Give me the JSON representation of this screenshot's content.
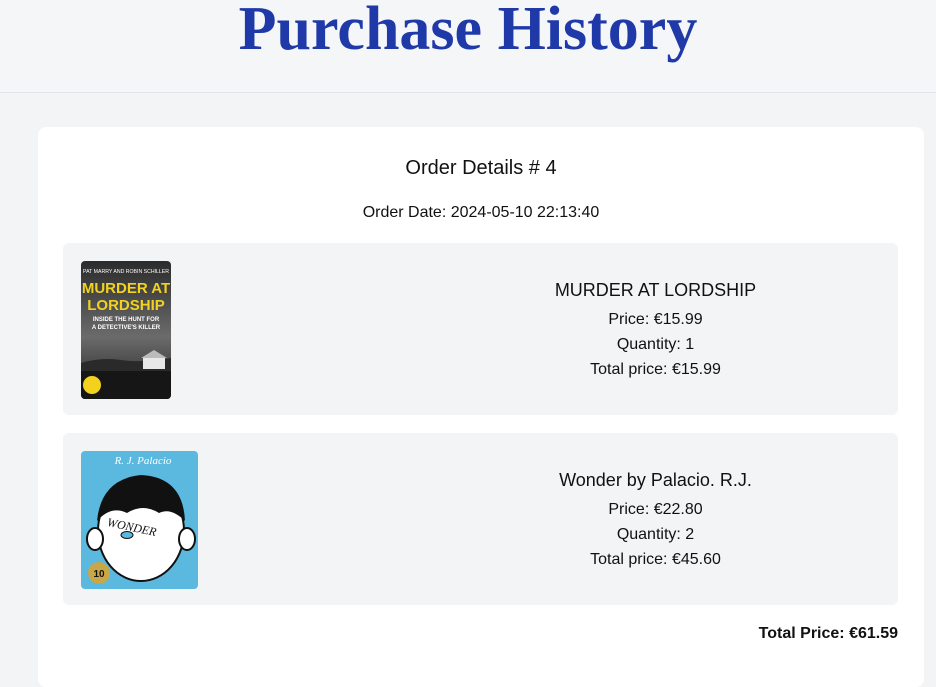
{
  "header": {
    "title": "Purchase History"
  },
  "order": {
    "heading": "Order Details # 4",
    "date_text": "Order Date: 2024-05-10 22:13:40",
    "items": [
      {
        "title": "MURDER AT LORDSHIP",
        "price": "Price: €15.99",
        "quantity": "Quantity: 1",
        "total": "Total price: €15.99",
        "cover": {
          "authors": "PAT MARRY AND ROBIN SCHILLER",
          "title_line1": "MURDER AT",
          "title_line2": "LORDSHIP",
          "subtitle_line1": "INSIDE THE HUNT FOR",
          "subtitle_line2": "A DETECTIVE'S KILLER"
        }
      },
      {
        "title": "Wonder by Palacio. R.J.",
        "price": "Price: €22.80",
        "quantity": "Quantity: 2",
        "total": "Total price: €45.60",
        "cover": {
          "author": "R. J. Palacio",
          "title": "WONDER",
          "badge": "10"
        }
      }
    ],
    "grand_total": "Total Price: €61.59"
  },
  "colors": {
    "title_blue": "#1f3aa8",
    "card_bg": "#ffffff",
    "item_bg": "#f3f4f6"
  }
}
